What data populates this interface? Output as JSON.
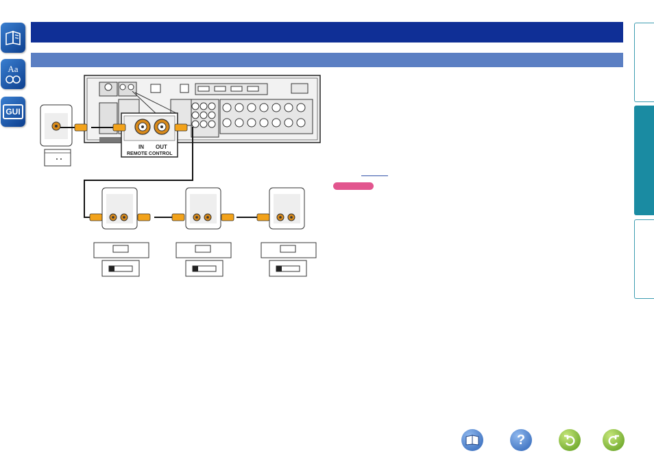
{
  "sidebar": {
    "icons": [
      {
        "name": "contents-book-icon",
        "label": ""
      },
      {
        "name": "index-aa-icon",
        "label": "Aa"
      },
      {
        "name": "gui-icon",
        "label": "GUI"
      }
    ]
  },
  "diagram": {
    "remote_in_label": "IN",
    "remote_out_label": "OUT",
    "remote_control_label": "REMOTE CONTROL"
  },
  "tabs": [
    {
      "name": "tab-top",
      "active": false
    },
    {
      "name": "tab-middle",
      "active": true
    },
    {
      "name": "tab-bottom",
      "active": false
    }
  ],
  "colors": {
    "title_bar": "#0f2f96",
    "sub_bar": "#5b7fc3",
    "tab_active": "#1a8ba2",
    "note_label": "#e2558e",
    "cable": "#f2a21a"
  },
  "footer": {
    "buttons": [
      {
        "name": "manual-book-icon",
        "symbol": "book"
      },
      {
        "name": "help-question-icon",
        "symbol": "?"
      },
      {
        "name": "undo-back-icon",
        "symbol": "back"
      },
      {
        "name": "redo-forward-icon",
        "symbol": "forward"
      }
    ]
  }
}
